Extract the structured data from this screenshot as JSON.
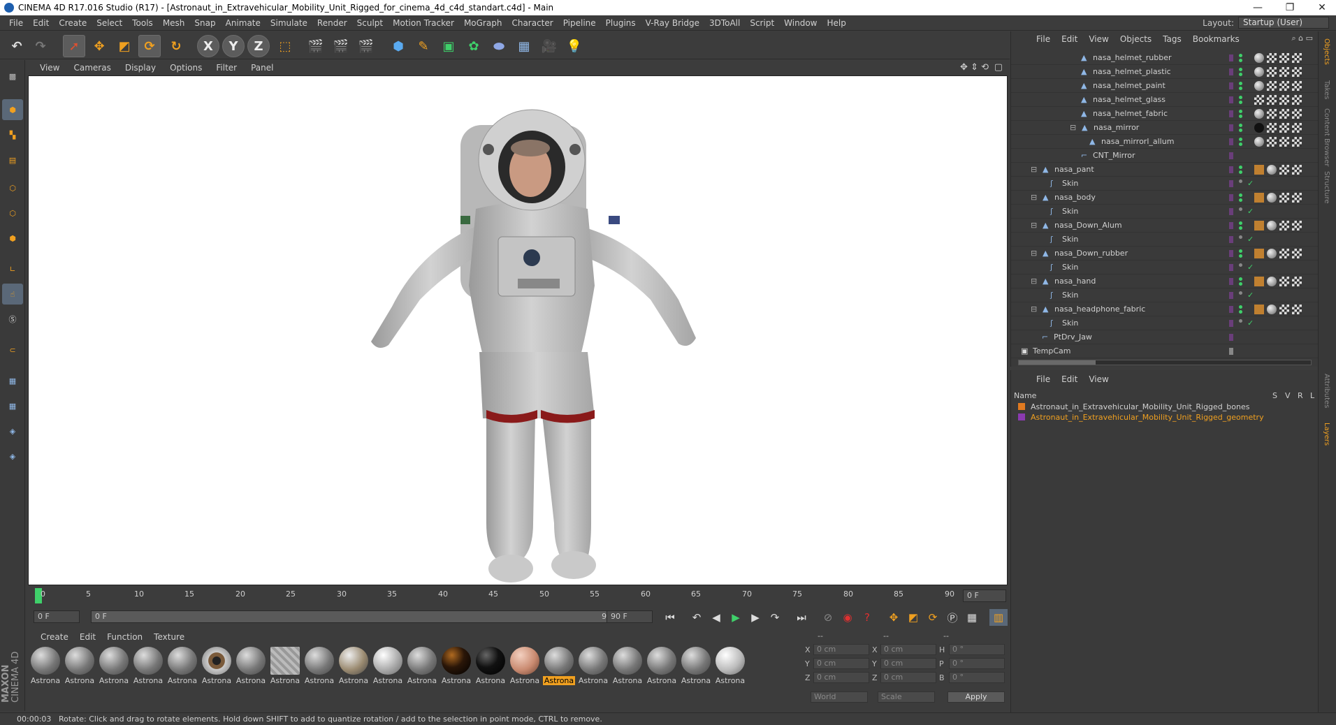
{
  "window": {
    "title": "CINEMA 4D R17.016 Studio (R17) - [Astronaut_in_Extravehicular_Mobility_Unit_Rigged_for_cinema_4d_c4d_standart.c4d] - Main",
    "minimize": "—",
    "restore": "❐",
    "close": "✕"
  },
  "menubar": {
    "items": [
      "File",
      "Edit",
      "Create",
      "Select",
      "Tools",
      "Mesh",
      "Snap",
      "Animate",
      "Simulate",
      "Render",
      "Sculpt",
      "Motion Tracker",
      "MoGraph",
      "Character",
      "Pipeline",
      "Plugins",
      "V-Ray Bridge",
      "3DToAll",
      "Script",
      "Window",
      "Help"
    ],
    "layout_label": "Layout:",
    "layout_value": "Startup (User)"
  },
  "toolbar": {
    "axis_x": "X",
    "axis_y": "Y",
    "axis_z": "Z"
  },
  "viewport": {
    "menu": [
      "View",
      "Cameras",
      "Display",
      "Options",
      "Filter",
      "Panel"
    ]
  },
  "timeline": {
    "ticks": [
      "0",
      "5",
      "10",
      "15",
      "20",
      "25",
      "30",
      "35",
      "40",
      "45",
      "50",
      "55",
      "60",
      "65",
      "70",
      "75",
      "80",
      "85",
      "90"
    ],
    "current_frame": "0 F",
    "start_frame": "0 F",
    "range_start": "0 F",
    "range_end": "90 F",
    "end_frame": "90 F"
  },
  "materials": {
    "menu": [
      "Create",
      "Edit",
      "Function",
      "Texture"
    ],
    "items": [
      "Astrona",
      "Astrona",
      "Astrona",
      "Astrona",
      "Astrona",
      "Astrona",
      "Astrona",
      "Astrona",
      "Astrona",
      "Astrona",
      "Astrona",
      "Astrona",
      "Astrona",
      "Astrona",
      "Astrona",
      "Astrona",
      "Astrona",
      "Astrona",
      "Astrona",
      "Astrona",
      "Astrona"
    ],
    "active_index": 15
  },
  "coords": {
    "headers": [
      "--",
      "--",
      "--"
    ],
    "rows": [
      {
        "a": "X",
        "av": "0 cm",
        "b": "X",
        "bv": "0 cm",
        "c": "H",
        "cv": "0 °"
      },
      {
        "a": "Y",
        "av": "0 cm",
        "b": "Y",
        "bv": "0 cm",
        "c": "P",
        "cv": "0 °"
      },
      {
        "a": "Z",
        "av": "0 cm",
        "b": "Z",
        "bv": "0 cm",
        "c": "B",
        "cv": "0 °"
      }
    ],
    "world": "World",
    "scale": "Scale",
    "apply": "Apply"
  },
  "status": {
    "time": "00:00:03",
    "message": "Rotate: Click and drag to rotate elements. Hold down SHIFT to add to quantize rotation / add to the selection in point mode, CTRL to remove."
  },
  "object_manager": {
    "menu": [
      "File",
      "Edit",
      "View",
      "Objects",
      "Tags",
      "Bookmarks"
    ],
    "rows": [
      {
        "label": "nasa_helmet_rubber"
      },
      {
        "label": "nasa_helmet_plastic"
      },
      {
        "label": "nasa_helmet_paint"
      },
      {
        "label": "nasa_helmet_glass"
      },
      {
        "label": "nasa_helmet_fabric"
      },
      {
        "label": "nasa_mirror"
      },
      {
        "label": "nasa_mirrorl_allum"
      },
      {
        "label": "CNT_Mirror"
      },
      {
        "label": "nasa_pant"
      },
      {
        "label": "Skin"
      },
      {
        "label": "nasa_body"
      },
      {
        "label": "Skin"
      },
      {
        "label": "nasa_Down_Alum"
      },
      {
        "label": "Skin"
      },
      {
        "label": "nasa_Down_rubber"
      },
      {
        "label": "Skin"
      },
      {
        "label": "nasa_hand"
      },
      {
        "label": "Skin"
      },
      {
        "label": "nasa_headphone_fabric"
      },
      {
        "label": "Skin"
      },
      {
        "label": "PtDrv_Jaw"
      },
      {
        "label": "TempCam"
      }
    ]
  },
  "layer_manager": {
    "menu": [
      "File",
      "Edit",
      "View"
    ],
    "columns": {
      "name": "Name",
      "s": "S",
      "v": "V",
      "r": "R",
      "l": "L"
    },
    "layers": [
      {
        "name": "Astronaut_in_Extravehicular_Mobility_Unit_Rigged_bones",
        "color": "#e07a20"
      },
      {
        "name": "Astronaut_in_Extravehicular_Mobility_Unit_Rigged_geometry",
        "color": "#8a3ab0"
      }
    ]
  },
  "right_strip": [
    "Objects",
    "Takes",
    "Content Browser",
    "Structure",
    "Attributes",
    "Layers"
  ],
  "brand": {
    "line1": "MAXON",
    "line2": "CINEMA 4D"
  },
  "accent": "#f0a020"
}
